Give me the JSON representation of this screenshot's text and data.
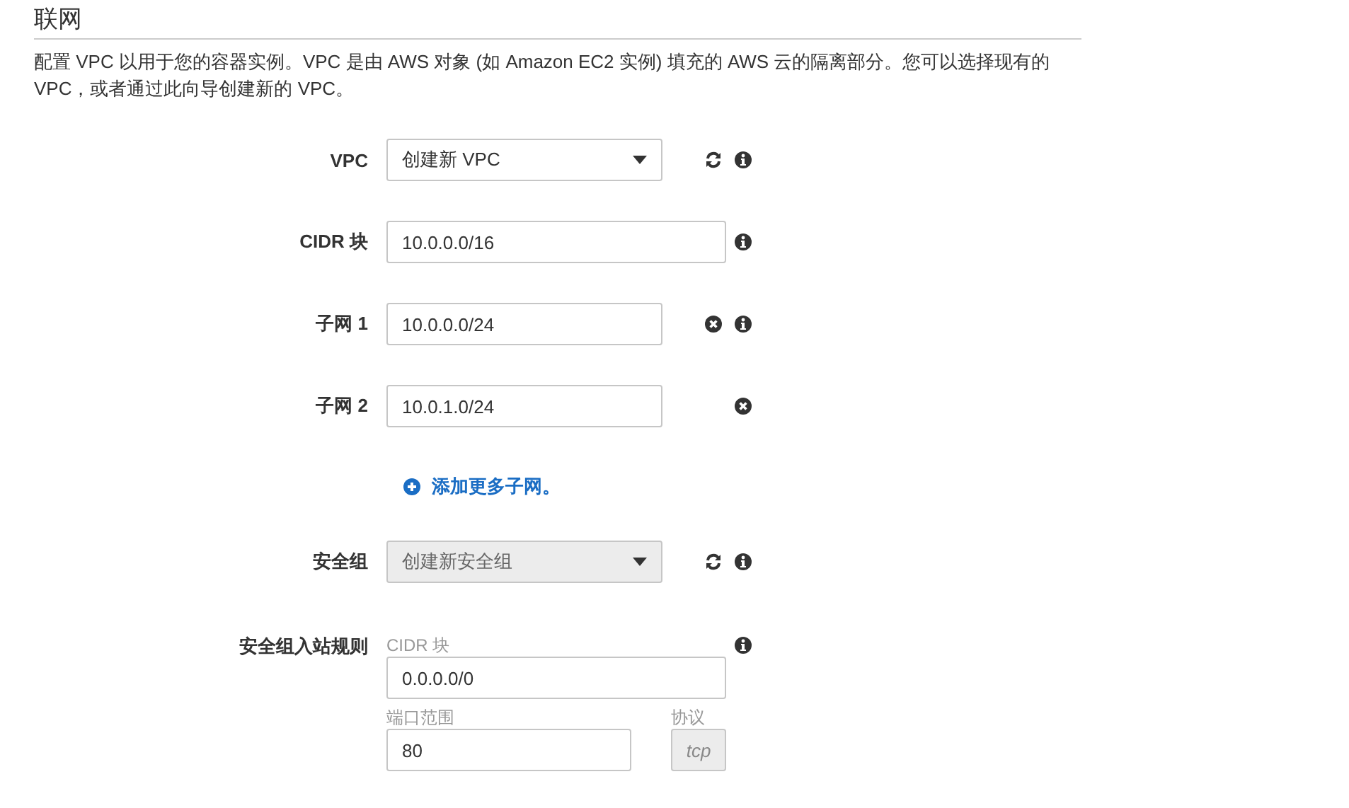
{
  "section": {
    "title": "联网",
    "description": "配置 VPC 以用于您的容器实例。VPC 是由 AWS 对象 (如 Amazon EC2 实例) 填充的 AWS 云的隔离部分。您可以选择现有的 VPC，或者通过此向导创建新的 VPC。"
  },
  "rows": [
    {
      "kind": "select",
      "label": "VPC",
      "value": "创建新 VPC",
      "disabled": false,
      "refresh": true,
      "info": true,
      "removable": false
    },
    {
      "kind": "input",
      "label": "CIDR 块",
      "value": "10.0.0.0/16",
      "refresh": false,
      "info": true,
      "removable": false
    },
    {
      "kind": "input",
      "label": "子网 1",
      "value": "10.0.0.0/24",
      "refresh": false,
      "info": true,
      "removable": true
    },
    {
      "kind": "input",
      "label": "子网 2",
      "value": "10.0.1.0/24",
      "refresh": false,
      "info": false,
      "removable": true
    },
    {
      "kind": "link",
      "text": "添加更多子网。"
    },
    {
      "kind": "select",
      "label": "安全组",
      "value": "创建新安全组",
      "disabled": true,
      "refresh": true,
      "info": true,
      "removable": false
    },
    {
      "kind": "rules",
      "label": "安全组入站规则",
      "cidr_label": "CIDR 块",
      "cidr_value": "0.0.0.0/0",
      "port_label": "端口范围",
      "port_value": "80",
      "protocol_label": "协议",
      "protocol_value": "tcp",
      "info": true
    }
  ]
}
